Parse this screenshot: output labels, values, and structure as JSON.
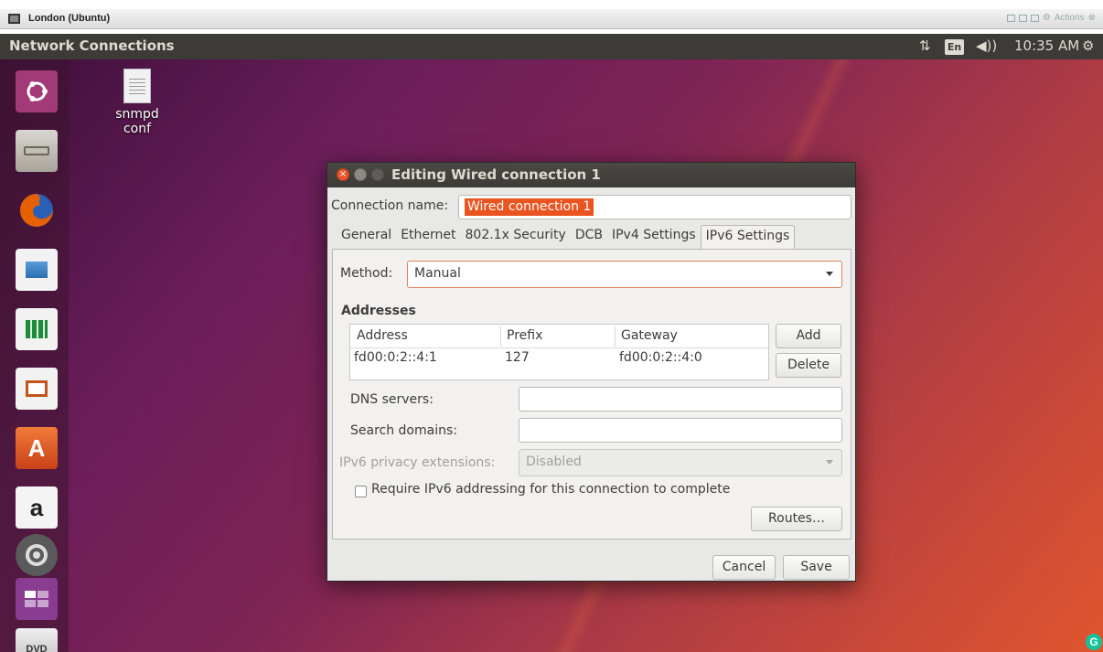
{
  "vm": {
    "title": "London (Ubuntu)",
    "actions_label": "Actions"
  },
  "panel": {
    "app_title": "Network Connections",
    "keyboard_indicator": "En",
    "clock": "10:35 AM"
  },
  "launcher": {
    "items": [
      {
        "icon": "ubuntu-dash-icon",
        "color": "#e95420"
      },
      {
        "icon": "file-cabinet-icon",
        "color": "#8a6a4a"
      },
      {
        "icon": "firefox-icon",
        "color": "#e66000"
      },
      {
        "icon": "libreoffice-writer-icon",
        "color": "#2a6fb0"
      },
      {
        "icon": "libreoffice-calc-icon",
        "color": "#1e8a3a"
      },
      {
        "icon": "libreoffice-impress-icon",
        "color": "#c2541c"
      },
      {
        "icon": "software-center-icon",
        "color": "#dd5a22"
      },
      {
        "icon": "amazon-icon",
        "color": "#ffffff"
      },
      {
        "icon": "system-settings-icon",
        "color": "#4a4a4a"
      },
      {
        "icon": "workspace-switcher-icon",
        "color": "#7a3a82"
      },
      {
        "icon": "dvd-drive-icon",
        "color": "#d8d8d8"
      }
    ]
  },
  "desktop": {
    "file_label": "snmpd conf"
  },
  "dialog": {
    "title": "Editing Wired connection 1",
    "connection_name_label": "Connection name:",
    "connection_name_value": "Wired connection 1",
    "tabs": [
      {
        "label": "General"
      },
      {
        "label": "Ethernet"
      },
      {
        "label": "802.1x Security"
      },
      {
        "label": "DCB"
      },
      {
        "label": "IPv4 Settings"
      },
      {
        "label": "IPv6 Settings",
        "active": true
      }
    ],
    "method_label": "Method:",
    "method_value": "Manual",
    "addresses_heading": "Addresses",
    "table": {
      "headers": [
        "Address",
        "Prefix",
        "Gateway"
      ],
      "rows": [
        {
          "address": "fd00:0:2::4:1",
          "prefix": "127",
          "gateway": "fd00:0:2::4:0"
        }
      ]
    },
    "add_label": "Add",
    "delete_label": "Delete",
    "dns_label": "DNS servers:",
    "dns_value": "",
    "search_label": "Search domains:",
    "search_value": "",
    "privacy_label": "IPv6 privacy extensions:",
    "privacy_value": "Disabled",
    "require_label": "Require IPv6 addressing for this connection to complete",
    "require_checked": false,
    "routes_label": "Routes…",
    "cancel_label": "Cancel",
    "save_label": "Save"
  },
  "colors": {
    "accent": "#e95420",
    "panel_bg": "#3c3b37"
  }
}
